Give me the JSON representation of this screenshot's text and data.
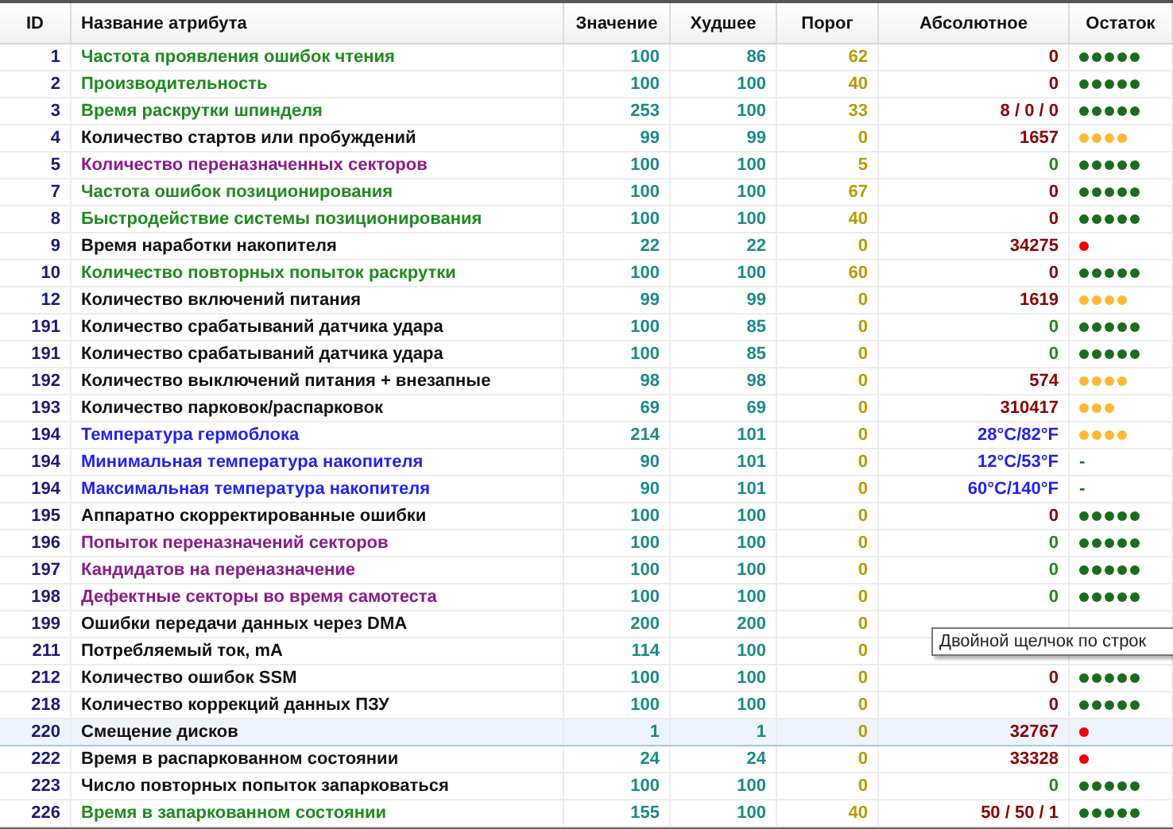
{
  "table": {
    "columns": [
      "ID",
      "Название атрибута",
      "Значение",
      "Худшее",
      "Порог",
      "Абсолютное",
      "Остаток"
    ],
    "rows": [
      {
        "id": "1",
        "name": "Частота проявления ошибок чтения",
        "color": "#1e8a1e",
        "value": "100",
        "worst": "86",
        "threshold": "62",
        "absolute": {
          "text": "0",
          "color": "#8b0000"
        },
        "remaining": {
          "stars": 5,
          "color": "#1a6e1a"
        },
        "selected": false
      },
      {
        "id": "2",
        "name": "Производительность",
        "color": "#1e8a1e",
        "value": "100",
        "worst": "100",
        "threshold": "40",
        "absolute": {
          "text": "0",
          "color": "#8b0000"
        },
        "remaining": {
          "stars": 5,
          "color": "#1a6e1a"
        },
        "selected": false
      },
      {
        "id": "3",
        "name": "Время раскрутки шпинделя",
        "color": "#1e8a1e",
        "value": "253",
        "worst": "100",
        "threshold": "33",
        "absolute": {
          "text": "8 / 0 / 0",
          "color": "#8b0000"
        },
        "remaining": {
          "stars": 5,
          "color": "#1a6e1a"
        },
        "selected": false
      },
      {
        "id": "4",
        "name": "Количество стартов или пробуждений",
        "color": "#111111",
        "value": "99",
        "worst": "99",
        "threshold": "0",
        "absolute": {
          "text": "1657",
          "color": "#8b0000"
        },
        "remaining": {
          "stars": 4,
          "color": "#ffb833"
        },
        "selected": false
      },
      {
        "id": "5",
        "name": "Количество переназначенных секторов",
        "color": "#8b1a8b",
        "value": "100",
        "worst": "100",
        "threshold": "5",
        "absolute": {
          "text": "0",
          "color": "#1e8a1e"
        },
        "remaining": {
          "stars": 5,
          "color": "#1a6e1a"
        },
        "selected": false
      },
      {
        "id": "7",
        "name": "Частота ошибок позиционирования",
        "color": "#1e8a1e",
        "value": "100",
        "worst": "100",
        "threshold": "67",
        "absolute": {
          "text": "0",
          "color": "#8b0000"
        },
        "remaining": {
          "stars": 5,
          "color": "#1a6e1a"
        },
        "selected": false
      },
      {
        "id": "8",
        "name": "Быстродействие системы позиционирования",
        "color": "#1e8a1e",
        "value": "100",
        "worst": "100",
        "threshold": "40",
        "absolute": {
          "text": "0",
          "color": "#8b0000"
        },
        "remaining": {
          "stars": 5,
          "color": "#1a6e1a"
        },
        "selected": false
      },
      {
        "id": "9",
        "name": "Время наработки накопителя",
        "color": "#111111",
        "value": "22",
        "worst": "22",
        "threshold": "0",
        "absolute": {
          "text": "34275",
          "color": "#8b0000"
        },
        "remaining": {
          "color": "#ee0000"
        },
        "selected": false
      },
      {
        "id": "10",
        "name": "Количество повторных попыток раскрутки",
        "color": "#1e8a1e",
        "value": "100",
        "worst": "100",
        "threshold": "60",
        "absolute": {
          "text": "0",
          "color": "#8b0000"
        },
        "remaining": {
          "stars": 5,
          "color": "#1a6e1a"
        },
        "selected": false
      },
      {
        "id": "12",
        "name": "Количество включений питания",
        "color": "#111111",
        "value": "99",
        "worst": "99",
        "threshold": "0",
        "absolute": {
          "text": "1619",
          "color": "#8b0000"
        },
        "remaining": {
          "stars": 4,
          "color": "#ffb833"
        },
        "selected": false
      },
      {
        "id": "191",
        "name": "Количество срабатываний датчика удара",
        "color": "#111111",
        "value": "100",
        "worst": "85",
        "threshold": "0",
        "absolute": {
          "text": "0",
          "color": "#1e8a1e"
        },
        "remaining": {
          "stars": 5,
          "color": "#1a6e1a"
        },
        "selected": false
      },
      {
        "id": "191",
        "name": "Количество срабатываний датчика удара",
        "color": "#111111",
        "value": "100",
        "worst": "85",
        "threshold": "0",
        "absolute": {
          "text": "0",
          "color": "#1e8a1e"
        },
        "remaining": {
          "stars": 5,
          "color": "#1a6e1a"
        },
        "selected": false
      },
      {
        "id": "192",
        "name": "Количество выключений питания + внезапные",
        "color": "#111111",
        "value": "98",
        "worst": "98",
        "threshold": "0",
        "absolute": {
          "text": "574",
          "color": "#8b0000"
        },
        "remaining": {
          "stars": 4,
          "color": "#ffb833"
        },
        "selected": false
      },
      {
        "id": "193",
        "name": "Количество парковок/распарковок",
        "color": "#111111",
        "value": "69",
        "worst": "69",
        "threshold": "0",
        "absolute": {
          "text": "310417",
          "color": "#8b0000"
        },
        "remaining": {
          "stars": 3,
          "color": "#ffb833"
        },
        "selected": false
      },
      {
        "id": "194",
        "name": "Температура гермоблока",
        "color": "#2222ee",
        "value": "214",
        "worst": "101",
        "threshold": "0",
        "absolute": {
          "text": "28°C/82°F",
          "color": "#2222ee"
        },
        "remaining": {
          "stars": 4,
          "color": "#ffb833"
        },
        "selected": false
      },
      {
        "id": "194",
        "name": "Минимальная температура накопителя",
        "color": "#2222ee",
        "value": "90",
        "worst": "101",
        "threshold": "0",
        "absolute": {
          "text": "12°C/53°F",
          "color": "#2222ee"
        },
        "remaining": {
          "text": "-"
        },
        "selected": false
      },
      {
        "id": "194",
        "name": "Максимальная температура накопителя",
        "color": "#2222ee",
        "value": "90",
        "worst": "101",
        "threshold": "0",
        "absolute": {
          "text": "60°C/140°F",
          "color": "#2222ee"
        },
        "remaining": {
          "text": "-"
        },
        "selected": false
      },
      {
        "id": "195",
        "name": "Аппаратно скорректированные ошибки",
        "color": "#111111",
        "value": "100",
        "worst": "100",
        "threshold": "0",
        "absolute": {
          "text": "0",
          "color": "#8b0000"
        },
        "remaining": {
          "stars": 5,
          "color": "#1a6e1a"
        },
        "selected": false
      },
      {
        "id": "196",
        "name": "Попыток переназначений секторов",
        "color": "#8b1a8b",
        "value": "100",
        "worst": "100",
        "threshold": "0",
        "absolute": {
          "text": "0",
          "color": "#1e8a1e"
        },
        "remaining": {
          "stars": 5,
          "color": "#1a6e1a"
        },
        "selected": false
      },
      {
        "id": "197",
        "name": "Кандидатов на переназначение",
        "color": "#8b1a8b",
        "value": "100",
        "worst": "100",
        "threshold": "0",
        "absolute": {
          "text": "0",
          "color": "#1e8a1e"
        },
        "remaining": {
          "stars": 5,
          "color": "#1a6e1a"
        },
        "selected": false
      },
      {
        "id": "198",
        "name": "Дефектные секторы во время самотеста",
        "color": "#8b1a8b",
        "value": "100",
        "worst": "100",
        "threshold": "0",
        "absolute": {
          "text": "0",
          "color": "#1e8a1e"
        },
        "remaining": {
          "stars": 5,
          "color": "#1a6e1a"
        },
        "selected": false
      },
      {
        "id": "199",
        "name": "Ошибки передачи данных через DMA",
        "color": "#111111",
        "value": "200",
        "worst": "200",
        "threshold": "0",
        "selected": false
      },
      {
        "id": "211",
        "name": "Потребляемый ток, mA",
        "color": "#111111",
        "value": "114",
        "worst": "100",
        "threshold": "0",
        "selected": false
      },
      {
        "id": "212",
        "name": "Количество ошибок SSM",
        "color": "#111111",
        "value": "100",
        "worst": "100",
        "threshold": "0",
        "absolute": {
          "text": "0",
          "color": "#8b0000"
        },
        "remaining": {
          "stars": 5,
          "color": "#1a6e1a"
        },
        "selected": false
      },
      {
        "id": "218",
        "name": "Количество коррекций данных ПЗУ",
        "color": "#111111",
        "value": "100",
        "worst": "100",
        "threshold": "0",
        "absolute": {
          "text": "0",
          "color": "#8b0000"
        },
        "remaining": {
          "stars": 5,
          "color": "#1a6e1a"
        },
        "selected": false
      },
      {
        "id": "220",
        "name": "Смещение дисков",
        "color": "#111111",
        "value": "1",
        "worst": "1",
        "threshold": "0",
        "absolute": {
          "text": "32767",
          "color": "#8b0000"
        },
        "remaining": {
          "color": "#ee0000"
        },
        "selected": true
      },
      {
        "id": "222",
        "name": "Время в распаркованном состоянии",
        "color": "#111111",
        "value": "24",
        "worst": "24",
        "threshold": "0",
        "absolute": {
          "text": "33328",
          "color": "#8b0000"
        },
        "remaining": {
          "color": "#ee0000"
        },
        "selected": false
      },
      {
        "id": "223",
        "name": "Число повторных попыток запарковаться",
        "color": "#111111",
        "value": "100",
        "worst": "100",
        "threshold": "0",
        "absolute": {
          "text": "0",
          "color": "#1e8a1e"
        },
        "remaining": {
          "stars": 5,
          "color": "#1a6e1a"
        },
        "selected": false
      },
      {
        "id": "226",
        "name": "Время в запаркованном состоянии",
        "color": "#1e8a1e",
        "value": "155",
        "worst": "100",
        "threshold": "40",
        "absolute": {
          "text": "50 / 50 / 1",
          "color": "#8b0000"
        },
        "remaining": {
          "stars": 5,
          "color": "#1a6e1a"
        },
        "selected": false
      }
    ]
  },
  "tooltip": {
    "text": "Двойной щелчок по строк"
  }
}
